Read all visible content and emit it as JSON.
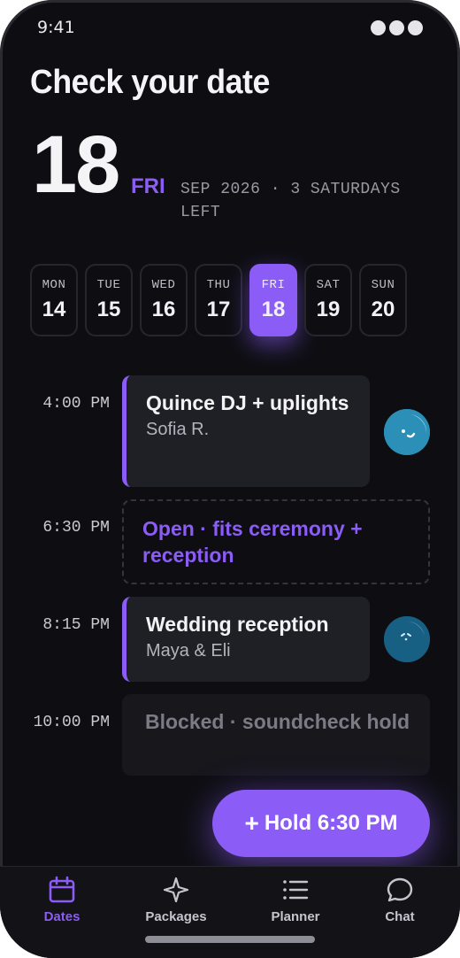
{
  "status": {
    "time": "9:41"
  },
  "header": {
    "title": "Check your date"
  },
  "selected": {
    "day": "18",
    "dow": "FRI",
    "info": "SEP 2026 · 3 SATURDAYS LEFT"
  },
  "week": [
    {
      "name": "MON",
      "num": "14"
    },
    {
      "name": "TUE",
      "num": "15"
    },
    {
      "name": "WED",
      "num": "16"
    },
    {
      "name": "THU",
      "num": "17"
    },
    {
      "name": "FRI",
      "num": "18"
    },
    {
      "name": "SAT",
      "num": "19"
    },
    {
      "name": "SUN",
      "num": "20"
    }
  ],
  "schedule": [
    {
      "time": "4:00 PM",
      "title": "Quince DJ + uplights",
      "sub": "Sofia R.",
      "state": "booked"
    },
    {
      "time": "6:30 PM",
      "title": "Open · fits ceremony + reception",
      "state": "open"
    },
    {
      "time": "8:15 PM",
      "title": "Wedding reception",
      "sub": "Maya & Eli",
      "state": "booked"
    },
    {
      "time": "10:00 PM",
      "title": "Blocked · soundcheck hold",
      "state": "blocked"
    }
  ],
  "fab": {
    "plus": "+",
    "label": "Hold 6:30 PM"
  },
  "tabs": [
    {
      "label": "Dates",
      "icon": "calendar-icon"
    },
    {
      "label": "Packages",
      "icon": "sparkle-icon"
    },
    {
      "label": "Planner",
      "icon": "list-icon"
    },
    {
      "label": "Chat",
      "icon": "chat-bubble-icon"
    }
  ],
  "colors": {
    "accent": "#8b5cf6",
    "background": "#0e0e12",
    "card": "#1f1f26"
  }
}
